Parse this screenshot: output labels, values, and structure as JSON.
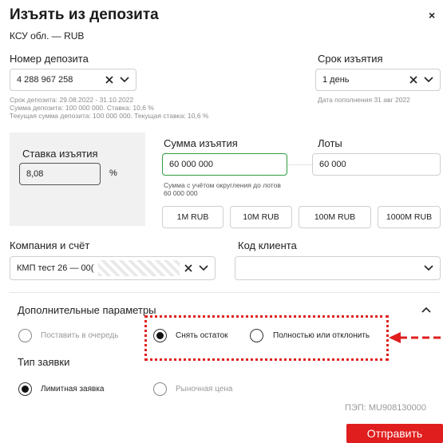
{
  "dialog": {
    "title": "Изъять из депозита",
    "subtitle": "КСУ обл. — RUB",
    "close_label": "×"
  },
  "deposit": {
    "label": "Номер депозита",
    "value": "4 288 967 258",
    "info_line1": "Срок депозита: 29.08.2022 - 31.10.2022",
    "info_line2": "Сумма депозита: 100 000 000. Ставка: 10,6 %",
    "info_line3": "Текущая сумма депозита: 100 000 000. Текущая ставка: 10,6 %"
  },
  "term": {
    "label": "Срок изъятия",
    "value": "1 день",
    "replenish_date": "Дата пополнения 31 авг 2022"
  },
  "rate": {
    "label": "Ставка изъятия",
    "value": "8,08",
    "unit": "%"
  },
  "amount": {
    "label": "Сумма изъятия",
    "value": "60 000 000",
    "hint": "Сумма с учётом округления до лотов 60 000 000"
  },
  "lots": {
    "label": "Лоты",
    "value": "60 000"
  },
  "amount_buttons": [
    "1M RUB",
    "10M RUB",
    "100M RUB",
    "1000M RUB"
  ],
  "company": {
    "label": "Компания и счёт",
    "value": "КМП тест 26 — 00("
  },
  "client_code": {
    "label": "Код клиента",
    "value": ""
  },
  "additional": {
    "label": "Дополнительные параметры",
    "options": [
      {
        "label": "Поставить в очередь",
        "selected": false,
        "disabled": true
      },
      {
        "label": "Снять остаток",
        "selected": true,
        "disabled": false
      },
      {
        "label": "Полностью или отклонить",
        "selected": false,
        "disabled": false
      }
    ]
  },
  "order_type": {
    "label": "Тип заявки",
    "options": [
      {
        "label": "Лимитная заявка",
        "selected": true,
        "disabled": false
      },
      {
        "label": "Рыночная цена",
        "selected": false,
        "disabled": true
      }
    ]
  },
  "pep": "ПЭП: MU908130000",
  "submit_label": "Отправить",
  "colors": {
    "accent": "#e01e1e",
    "active_border": "#2e9e3e"
  }
}
